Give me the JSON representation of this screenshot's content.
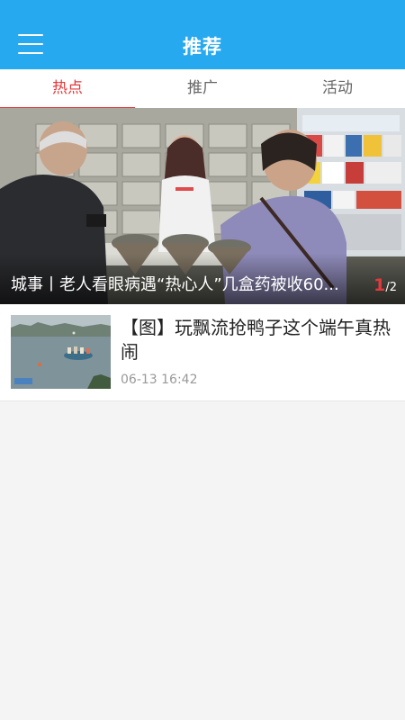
{
  "header": {
    "title": "推荐",
    "menu_icon": "hamburger-menu-icon"
  },
  "tabs": [
    {
      "label": "热点",
      "active": true
    },
    {
      "label": "推广",
      "active": false
    },
    {
      "label": "活动",
      "active": false
    }
  ],
  "banner": {
    "caption": "城事丨老人看眼病遇“热心人”几盒药被收60...",
    "current": "1",
    "total": "/2"
  },
  "news": [
    {
      "title": "【图】玩飘流抢鸭子这个端午真热闹",
      "time": "06-13 16:42"
    }
  ],
  "colors": {
    "header": "#27a9f0",
    "accent": "#e4393c",
    "background": "#f4f4f4"
  }
}
